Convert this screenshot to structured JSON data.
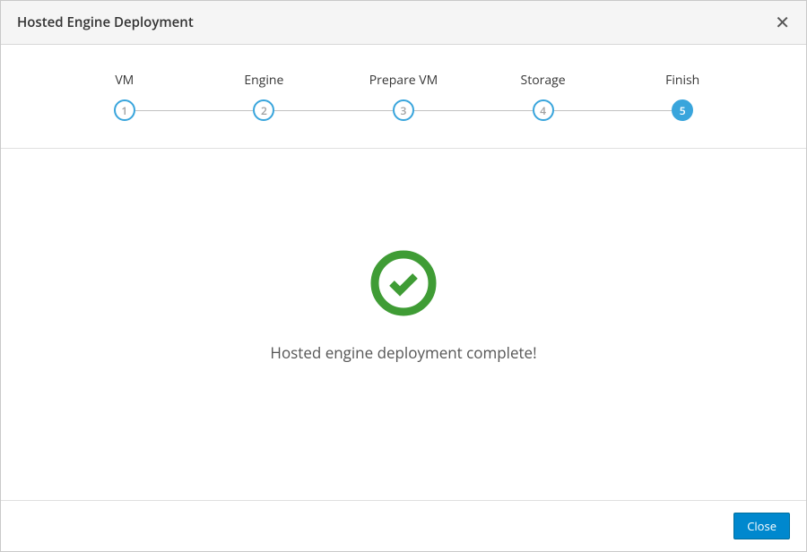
{
  "header": {
    "title": "Hosted Engine Deployment"
  },
  "wizard": {
    "steps": [
      {
        "label": "VM",
        "number": "1",
        "active": false
      },
      {
        "label": "Engine",
        "number": "2",
        "active": false
      },
      {
        "label": "Prepare VM",
        "number": "3",
        "active": false
      },
      {
        "label": "Storage",
        "number": "4",
        "active": false
      },
      {
        "label": "Finish",
        "number": "5",
        "active": true
      }
    ]
  },
  "content": {
    "success_message": "Hosted engine deployment complete!"
  },
  "footer": {
    "close_label": "Close"
  },
  "colors": {
    "accent": "#39a5dc",
    "success": "#3f9c35",
    "button": "#0088ce"
  }
}
